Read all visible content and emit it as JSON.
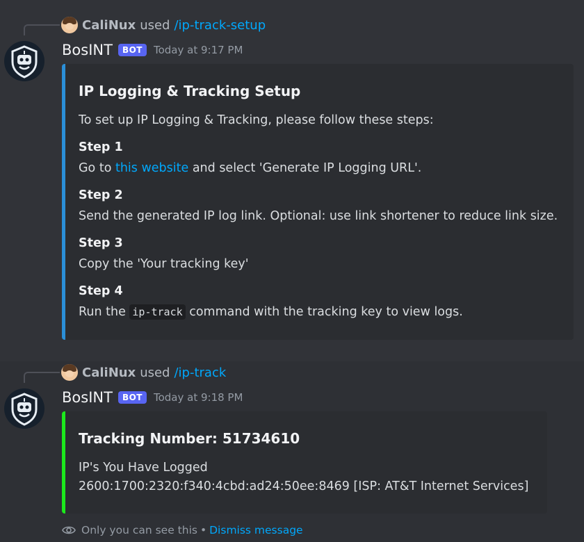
{
  "message1": {
    "reply": {
      "username": "CaliNux",
      "used": "used",
      "command": "/ip-track-setup"
    },
    "author": "BosINT",
    "bot_tag": "BOT",
    "timestamp": "Today at 9:17 PM",
    "embed": {
      "title": "IP Logging & Tracking Setup",
      "intro": "To set up IP Logging & Tracking, please follow these steps:",
      "steps": [
        {
          "name": "Step 1",
          "prefix": "Go to ",
          "link": "this website",
          "suffix": " and select 'Generate IP Logging URL'."
        },
        {
          "name": "Step 2",
          "text": "Send the generated IP log link. Optional: use link shortener to reduce link size."
        },
        {
          "name": "Step 3",
          "text": "Copy the 'Your tracking key'"
        },
        {
          "name": "Step 4",
          "prefix": "Run the ",
          "code": "ip-track",
          "suffix": " command with the tracking key to view logs."
        }
      ],
      "accent_color": "#2b8fd8"
    }
  },
  "message2": {
    "reply": {
      "username": "CaliNux",
      "used": "used",
      "command": "/ip-track"
    },
    "author": "BosINT",
    "bot_tag": "BOT",
    "timestamp": "Today at 9:18 PM",
    "embed": {
      "title": "Tracking Number: 51734610",
      "line1": "IP's You Have Logged",
      "line2": "2600:1700:2320:f340:4cbd:ad24:50ee:8469 [ISP: AT&T Internet Services]",
      "accent_color": "#1ce81c"
    },
    "footer": {
      "text": "Only you can see this",
      "separator": "•",
      "dismiss": "Dismiss message"
    }
  }
}
